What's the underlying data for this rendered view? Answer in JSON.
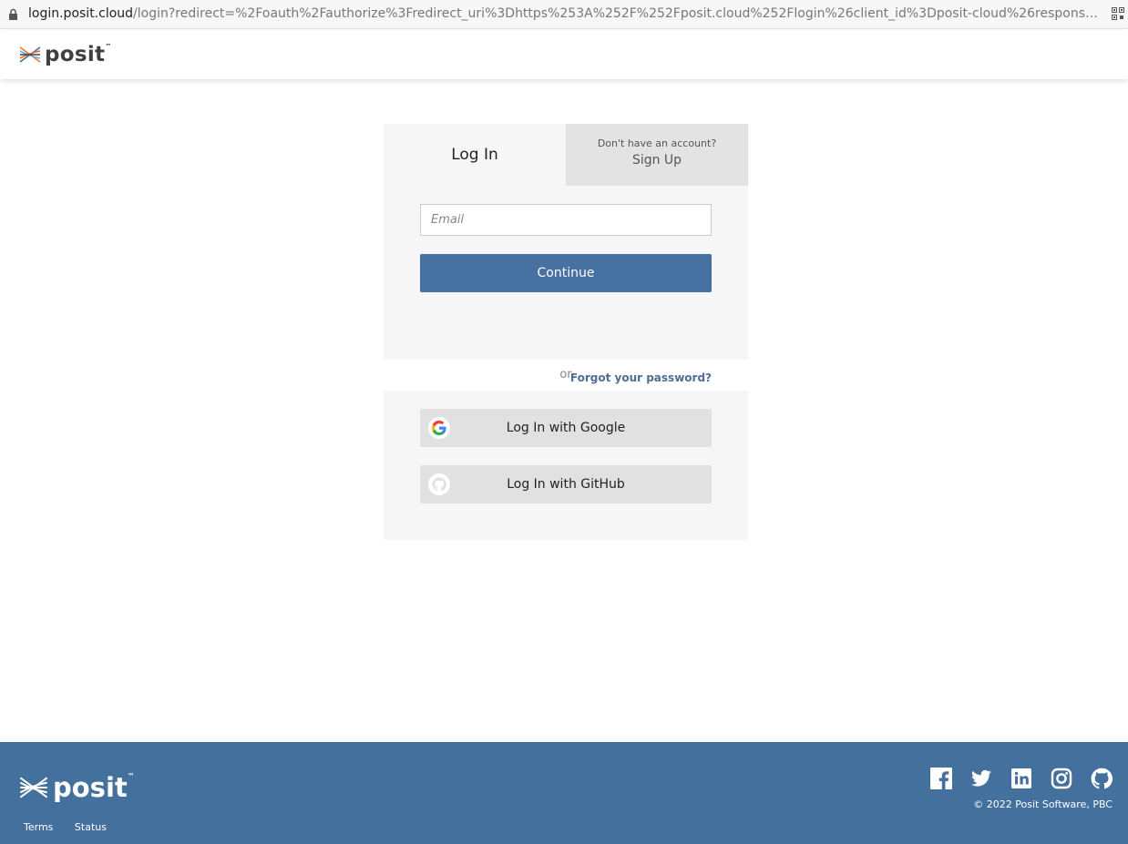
{
  "browser": {
    "url_host": "login.posit.cloud",
    "url_path": "/login?redirect=%2Foauth%2Fauthorize%3Fredirect_uri%3Dhttps%253A%252F%252Fposit.cloud%252Flogin%26client_id%3Dposit-cloud%26response_type%3..."
  },
  "header": {
    "brand": "posit",
    "tm": "™"
  },
  "tabs": {
    "login_label": "Log In",
    "signup_prompt": "Don't have an account?",
    "signup_label": "Sign Up"
  },
  "form": {
    "email_placeholder": "Email",
    "email_value": "",
    "continue_label": "Continue",
    "forgot_label": "Forgot your password?"
  },
  "divider": "or",
  "social": {
    "google_label": "Log In with Google",
    "github_label": "Log In with GitHub"
  },
  "footer": {
    "brand": "posit",
    "tm": "™",
    "links": [
      "Terms",
      "Status"
    ],
    "copyright": "© 2022 Posit Software, PBC",
    "social_icons": [
      "facebook-icon",
      "twitter-icon",
      "linkedin-icon",
      "instagram-icon",
      "github-icon"
    ]
  },
  "colors": {
    "primary": "#4671a0",
    "footer_bg": "#44709d",
    "panel_bg": "#f6f6f6",
    "tab_inactive_bg": "#e3e3e3",
    "link": "#4f6e93"
  }
}
